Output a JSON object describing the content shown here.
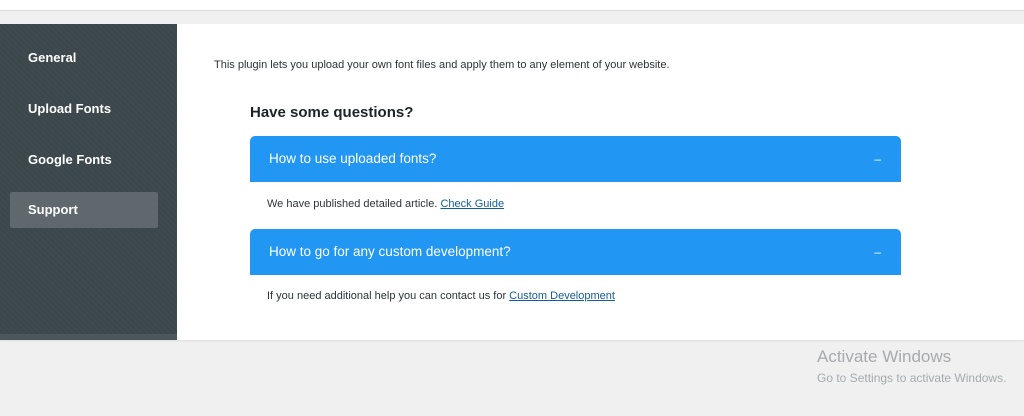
{
  "sidebar": {
    "items": [
      {
        "label": "General",
        "active": false
      },
      {
        "label": "Upload Fonts",
        "active": false
      },
      {
        "label": "Google Fonts",
        "active": false
      },
      {
        "label": "Support",
        "active": true
      }
    ]
  },
  "main": {
    "intro": "This plugin lets you upload your own font files and apply them to any element of your website.",
    "questions_title": "Have some questions?",
    "accordion": [
      {
        "question": "How to use uploaded fonts?",
        "toggle": "–",
        "answer_text": "We have published detailed article.",
        "answer_link": "Check Guide"
      },
      {
        "question": "How to go for any custom development?",
        "toggle": "–",
        "answer_text": "If you need additional help you can contact us for",
        "answer_link": "Custom Development"
      }
    ]
  },
  "watermark": {
    "title": "Activate Windows",
    "subtitle": "Go to Settings to activate Windows."
  },
  "colors": {
    "accent": "#2196f3",
    "sidebar": "#3c474b",
    "sidebar_active": "#5f696d",
    "link": "#135e96"
  }
}
